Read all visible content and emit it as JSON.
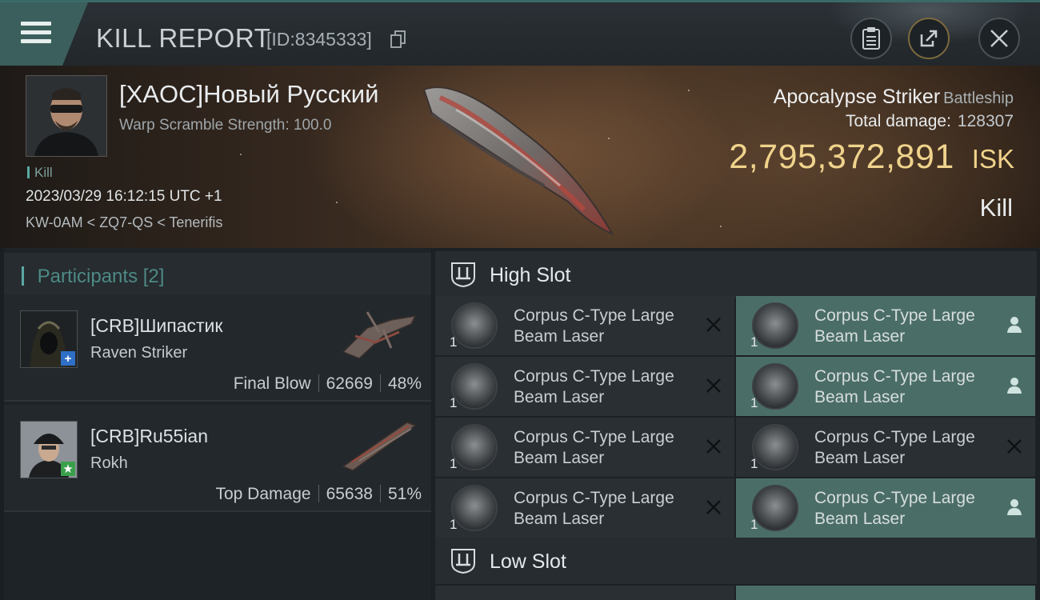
{
  "window": {
    "title": "KILL REPORT",
    "id_text": "[ID:8345333]"
  },
  "victim": {
    "name": "[XAOC]Новый Русский",
    "subtitle": "Warp Scramble Strength: 100.0",
    "tag": "Kill",
    "datetime": "2023/03/29 16:12:15 UTC +1",
    "location": "KW-0AM < ZQ7-QS < Tenerifis"
  },
  "ship": {
    "name": "Apocalypse Striker",
    "class": "Battleship",
    "total_damage_label": "Total damage:",
    "total_damage": "128307",
    "isk_value": "2,795,372,891",
    "isk_unit": "ISK",
    "result": "Kill"
  },
  "participants": {
    "title": "Participants",
    "count": "[2]",
    "items": [
      {
        "name": "[CRB]Шипастик",
        "ship": "Raven Striker",
        "role": "Final Blow",
        "damage": "62669",
        "percent": "48%",
        "badge": "+",
        "badge_color": "#2f6fc6"
      },
      {
        "name": "[CRB]Ru55ian",
        "ship": "Rokh",
        "role": "Top Damage",
        "damage": "65638",
        "percent": "51%",
        "badge": "★",
        "badge_color": "#3aa04b"
      }
    ]
  },
  "slots": {
    "high_title": "High Slot",
    "low_title": "Low Slot",
    "high_modules": [
      {
        "qty": "1",
        "line1": "Corpus C-Type Large",
        "line2": "Beam Laser",
        "status": "destroyed"
      },
      {
        "qty": "1",
        "line1": "Corpus C-Type Large",
        "line2": "Beam Laser",
        "status": "dropped"
      },
      {
        "qty": "1",
        "line1": "Corpus C-Type Large",
        "line2": "Beam Laser",
        "status": "destroyed"
      },
      {
        "qty": "1",
        "line1": "Corpus C-Type Large",
        "line2": "Beam Laser",
        "status": "dropped"
      },
      {
        "qty": "1",
        "line1": "Corpus C-Type Large",
        "line2": "Beam Laser",
        "status": "destroyed"
      },
      {
        "qty": "1",
        "line1": "Corpus C-Type Large",
        "line2": "Beam Laser",
        "status": "destroyed"
      },
      {
        "qty": "1",
        "line1": "Corpus C-Type Large",
        "line2": "Beam Laser",
        "status": "destroyed"
      },
      {
        "qty": "1",
        "line1": "Corpus C-Type Large",
        "line2": "Beam Laser",
        "status": "dropped"
      }
    ]
  },
  "colors": {
    "accent": "#5aa8a2",
    "isk": "#f0d38c",
    "fitted_bg": "#4b6d68"
  }
}
